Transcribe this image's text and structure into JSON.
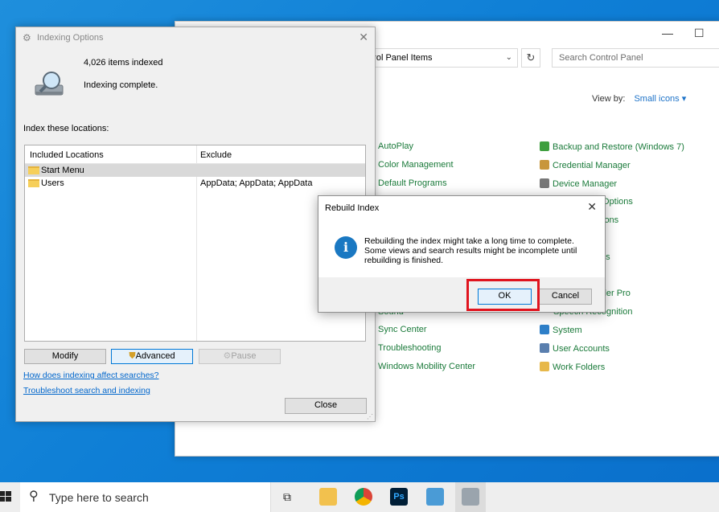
{
  "control_panel": {
    "address": "ntrol Panel Items",
    "search_placeholder": "Search Control Panel",
    "view_by_label": "View by:",
    "view_by_value": "Small icons",
    "items_left": [
      "AutoPlay",
      "Color Management",
      "Default Programs",
      "Sound",
      "Sync Center",
      "Troubleshooting",
      "Windows Mobility Center"
    ],
    "items_right": [
      "Backup and Restore (Windows 7)",
      "Credential Manager",
      "Device Manager",
      "Options",
      "ions",
      "ns",
      "ller Pro",
      "Speech Recognition",
      "System",
      "User Accounts",
      "Work Folders"
    ]
  },
  "indexing_options": {
    "title": "Indexing Options",
    "items_indexed": "4,026 items indexed",
    "status": "Indexing complete.",
    "locations_label": "Index these locations:",
    "columns": [
      "Included Locations",
      "Exclude"
    ],
    "rows": [
      {
        "location": "Start Menu",
        "exclude": ""
      },
      {
        "location": "Users",
        "exclude": "AppData; AppData; AppData"
      }
    ],
    "buttons": {
      "modify": "Modify",
      "advanced": "Advanced",
      "pause": "Pause",
      "close": "Close"
    },
    "links": [
      "How does indexing affect searches?",
      "Troubleshoot search and indexing"
    ]
  },
  "rebuild_index": {
    "title": "Rebuild Index",
    "message_lines": [
      "Rebuilding the index might take a long time to complete.",
      "Some views and search results might be incomplete until",
      "rebuilding is finished."
    ],
    "ok_label": "OK",
    "cancel_label": "Cancel"
  },
  "taskbar": {
    "search_placeholder": "Type here to search",
    "photoshop_label": "Ps"
  }
}
